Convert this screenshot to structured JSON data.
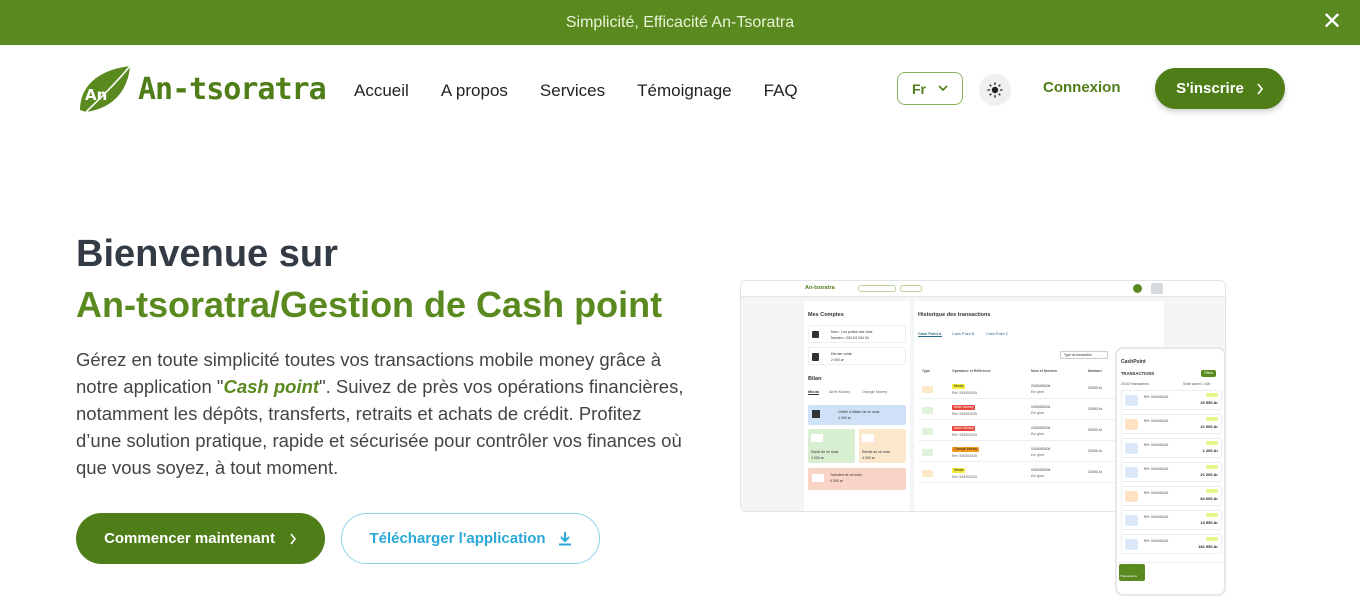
{
  "announcement": {
    "text": "Simplicité, Efficacité An-Tsoratra",
    "close_icon": "close-icon"
  },
  "header": {
    "logo_badge": "An",
    "logo_text": "An-tsoratra",
    "nav": [
      "Accueil",
      "A propos",
      "Services",
      "Témoignage",
      "FAQ"
    ],
    "language": "Fr",
    "login": "Connexion",
    "signup": "S'inscrire"
  },
  "hero": {
    "title_line1": "Bienvenue sur",
    "title_line2": "An-tsoratra/Gestion de Cash point",
    "text_before": "Gérez en toute simplicité toutes vos transactions mobile money grâce à notre application \"",
    "text_brand": "Cash point",
    "text_after": "\". Suivez de près vos opérations financières, notamment les dépôts, transferts, retraits et achats de crédit. Profitez d’une solution pratique, rapide et sécurisée pour contrôler vos finances où que vous soyez, à tout moment.",
    "cta_primary": "Commencer maintenant",
    "cta_secondary": "Télécharger l'application"
  },
  "mockup": {
    "logo": "An-tsoratra",
    "side_title": "Mes Comptes",
    "account_name": "Nom : Les portes des vitus",
    "account_number": "Numéro : 034 04 034 04",
    "balance_label": "Dernier solde",
    "balance_value": "2 000 ar",
    "bilan": "Bilan",
    "tabs": [
      "Mvola",
      "Airtel Money",
      "Orange Money"
    ],
    "ca_label": "Chiffre d'affaire de ce mois",
    "ca_value": "4 000 ar",
    "depot_label": "Dépôt de ce mois",
    "depot_value": "4 000 ar",
    "retrait_label": "Retrait de ce mois",
    "retrait_value": "4 000 ar",
    "transfert_label": "Transfert de ce mois",
    "transfert_value": "4 000 ar",
    "history_title": "Historique des transactions",
    "cash_points": [
      "Cash Point A",
      "Cash Point B",
      "Cash Point C"
    ],
    "filter": "Type de transaction",
    "columns": [
      "Type",
      "Opérateur et Référence",
      "Nom et Numero",
      "Montant"
    ],
    "rows": [
      {
        "op": "Mvola",
        "ref": "Ref: 545353035",
        "num": "0345453404",
        "name": "Em ghre",
        "amt": "20000 Ar"
      },
      {
        "op": "Airtel Money",
        "ref": "Ref: 545353035",
        "num": "0345453404",
        "name": "Em ghre",
        "amt": "20000 Ar"
      },
      {
        "op": "Airtel Money",
        "ref": "Ref: 545353035",
        "num": "0345453404",
        "name": "Em ghre",
        "amt": "20000 Ar"
      },
      {
        "op": "Orange Money",
        "ref": "Ref: 545353035",
        "num": "0345453404",
        "name": "Em ghre",
        "amt": "20000 Ar"
      },
      {
        "op": "Mvola",
        "ref": "Ref: 545353035",
        "num": "0345453404",
        "name": "Em ghre",
        "amt": "20000 Ar"
      }
    ],
    "phone": {
      "app": "CashPoint",
      "title": "TRANSACTIONS",
      "filter": "Filtres",
      "count": "20.007 transactions",
      "balance": "Solde actuel 1 444r",
      "amounts": [
        "20 550 Ar",
        "21 000 Ar",
        "1 200 Ar",
        "21 200 Ar",
        "84 000 Ar",
        "13 550 Ar",
        "181 950 Ar"
      ],
      "tab": "Transactions"
    }
  },
  "colors": {
    "brand": "#4f7d18",
    "topbar": "#5a8a1f",
    "accent_blue": "#2aa8d8"
  }
}
